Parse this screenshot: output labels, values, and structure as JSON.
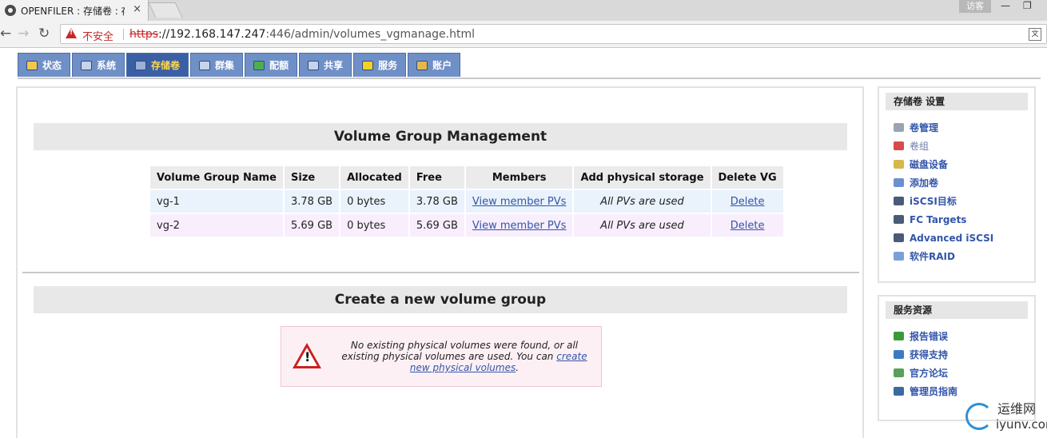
{
  "browser": {
    "tab_title": "OPENFILER : 存储卷 : 存",
    "tab_close": "×",
    "user_button": "访客",
    "minimize": "—",
    "maximize": "❐",
    "url_warning": "不安全",
    "url_scheme": "https",
    "url_host": "://192.168.147.247",
    "url_path": ":446/admin/volumes_vgmanage.html"
  },
  "nav": {
    "items": [
      {
        "label": "状态",
        "icon": "status-icon",
        "color": "#f2c84b"
      },
      {
        "label": "系统",
        "icon": "system-icon",
        "color": "#c7d3e8"
      },
      {
        "label": "存储卷",
        "icon": "volumes-icon",
        "color": "#9bb0d6"
      },
      {
        "label": "群集",
        "icon": "cluster-icon",
        "color": "#c7d3e8"
      },
      {
        "label": "配额",
        "icon": "quota-icon",
        "color": "#4caf50"
      },
      {
        "label": "共享",
        "icon": "shares-icon",
        "color": "#c7d3e8"
      },
      {
        "label": "服务",
        "icon": "services-icon",
        "color": "#f5d020"
      },
      {
        "label": "账户",
        "icon": "accounts-icon",
        "color": "#e6b84a"
      }
    ],
    "active_index": 2
  },
  "main": {
    "vg_section_title": "Volume Group Management",
    "table": {
      "headers": [
        "Volume Group Name",
        "Size",
        "Allocated",
        "Free",
        "Members",
        "Add physical storage",
        "Delete VG"
      ],
      "rows": [
        {
          "name": "vg-1",
          "size": "3.78 GB",
          "allocated": "0 bytes",
          "free": "3.78 GB",
          "members": "View member PVs",
          "add": "All PVs are used",
          "delete": "Delete"
        },
        {
          "name": "vg-2",
          "size": "5.69 GB",
          "allocated": "0 bytes",
          "free": "5.69 GB",
          "members": "View member PVs",
          "add": "All PVs are used",
          "delete": "Delete"
        }
      ]
    },
    "create_section_title": "Create a new volume group",
    "alert": {
      "text_before": "No existing physical volumes were found, or all existing physical volumes are used. You can ",
      "link_text": "create new physical volumes",
      "text_after": "."
    }
  },
  "sidebar": {
    "settings_title": "存储卷 设置",
    "settings_items": [
      {
        "label": "卷管理",
        "icon": "volume-mgmt-icon",
        "color": "#9aa4b5"
      },
      {
        "label": "卷组",
        "icon": "volume-group-icon",
        "color": "#d94a4a"
      },
      {
        "label": "磁盘设备",
        "icon": "disk-icon",
        "color": "#d4b84a"
      },
      {
        "label": "添加卷",
        "icon": "add-volume-icon",
        "color": "#6b8fd0"
      },
      {
        "label": "iSCSI目标",
        "icon": "iscsi-icon",
        "color": "#4a5a78"
      },
      {
        "label": "FC Targets",
        "icon": "fc-icon",
        "color": "#4a5a78"
      },
      {
        "label": "Advanced iSCSI",
        "icon": "advanced-iscsi-icon",
        "color": "#4a5a78"
      },
      {
        "label": "软件RAID",
        "icon": "raid-icon",
        "color": "#7aa0d8"
      }
    ],
    "resources_title": "服务资源",
    "resources_items": [
      {
        "label": "报告错误",
        "icon": "bug-icon",
        "color": "#3a9a3a"
      },
      {
        "label": "获得支持",
        "icon": "support-icon",
        "color": "#3a7ac0"
      },
      {
        "label": "官方论坛",
        "icon": "forum-icon",
        "color": "#5aa05a"
      },
      {
        "label": "管理员指南",
        "icon": "guide-icon",
        "color": "#3a6aa0"
      }
    ]
  },
  "watermark": {
    "cn": "运维网",
    "en": "iyunv.com"
  }
}
